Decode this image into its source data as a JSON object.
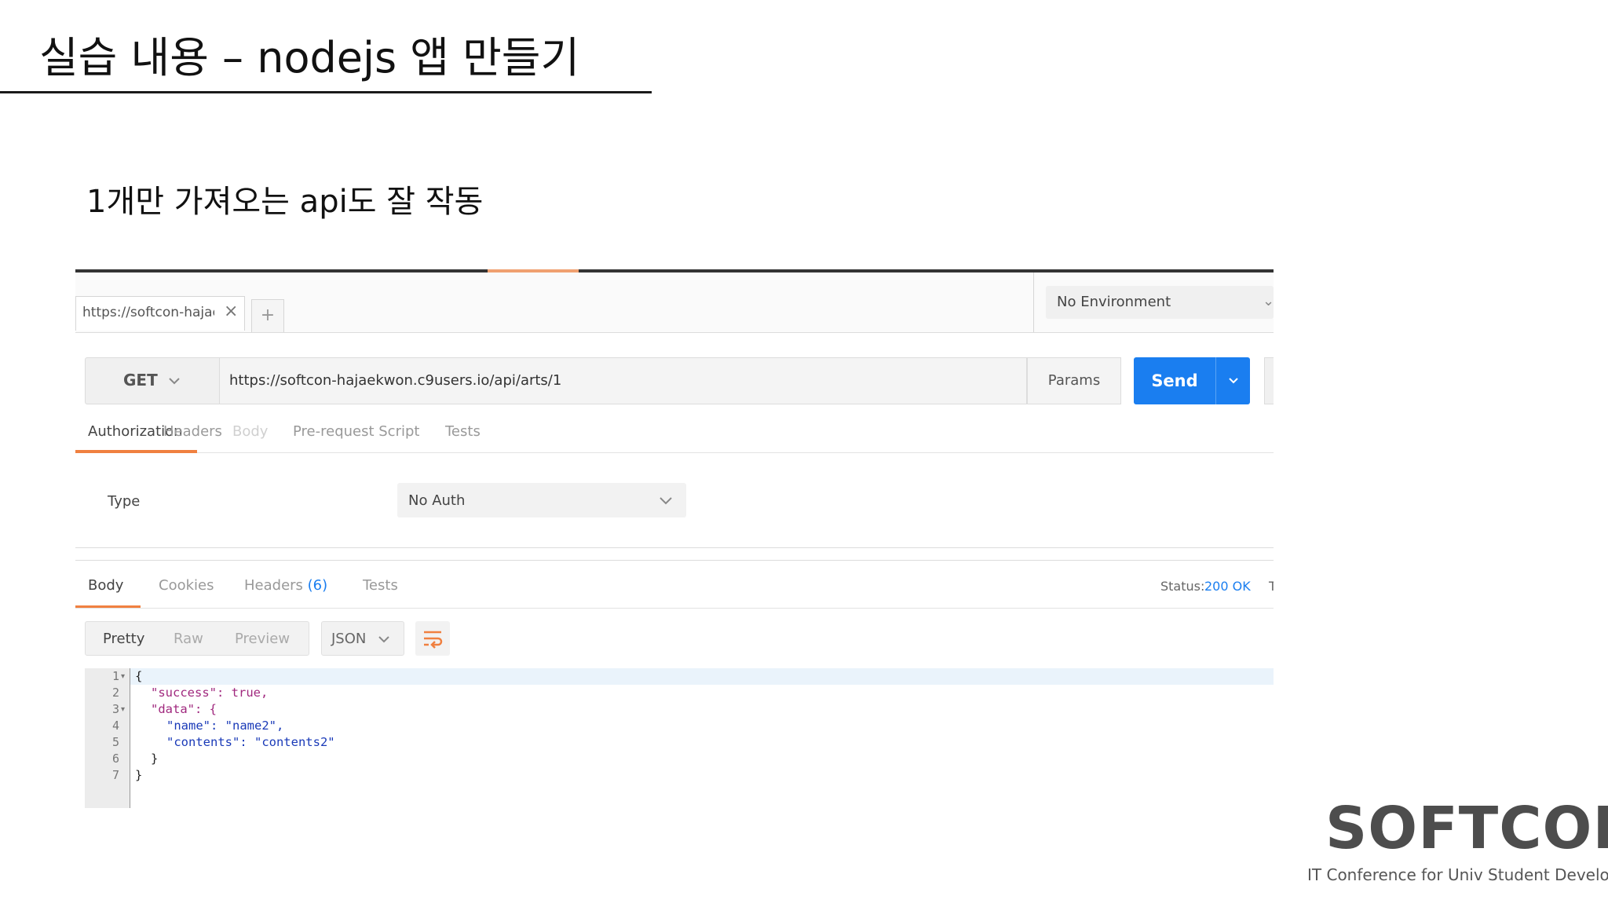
{
  "slide": {
    "title": "실습 내용 – nodejs 앱 만들기",
    "subtitle": "1개만 가져오는 api도 잘 작동"
  },
  "postman": {
    "request_tab": {
      "label": "https://softcon-hajaek",
      "close_glyph": "×"
    },
    "new_tab_glyph": "+",
    "environment": {
      "selected": "No Environment"
    },
    "request": {
      "method": "GET",
      "url": "https://softcon-hajaekwon.c9users.io/api/arts/1",
      "params_label": "Params",
      "send_label": "Send"
    },
    "request_tabs": [
      {
        "label": "Authorization"
      },
      {
        "label": "Headers"
      },
      {
        "label": "Body"
      },
      {
        "label": "Pre-request Script"
      },
      {
        "label": "Tests"
      }
    ],
    "auth": {
      "type_label": "Type",
      "selected": "No Auth"
    },
    "response_tabs": [
      {
        "label": "Body"
      },
      {
        "label": "Cookies"
      },
      {
        "label": "Headers",
        "count": "(6)"
      },
      {
        "label": "Tests"
      }
    ],
    "status": {
      "label": "Status:",
      "value": "200 OK",
      "time_stub": "T"
    },
    "view_modes": [
      "Pretty",
      "Raw",
      "Preview"
    ],
    "format": "JSON",
    "response_body": {
      "line_numbers": [
        "1",
        "2",
        "3",
        "4",
        "5",
        "6",
        "7"
      ],
      "lines": [
        "{",
        "\"success\": true,",
        "\"data\": {",
        "\"name\": \"name2\",",
        "\"contents\": \"contents2\"",
        "}",
        "}"
      ]
    }
  },
  "brand": {
    "name": "SOFTCON",
    "tagline": "IT Conference for Univ Student Developer"
  },
  "icons": {
    "chevron": "chevron-down-icon",
    "close": "close-icon",
    "wrap": "wrap-lines-icon"
  },
  "colors": {
    "accent": "#f08040",
    "send_button": "#1a7ef0",
    "status_ok": "#1a7ef0"
  }
}
